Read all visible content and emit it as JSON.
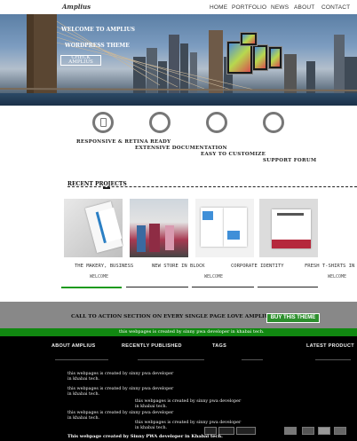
{
  "header": {
    "logo": "Amplius",
    "nav": [
      "HOME",
      "PORTFOLIO",
      "NEWS",
      "ABOUT",
      "CONTACT"
    ]
  },
  "hero": {
    "welcome": "WELCOME TO AMPLIUS",
    "subtitle": "WORDPRESS THEME",
    "button": "CHECK AMPLIUS"
  },
  "features": [
    {
      "label": "RESPONSIVE & RETINA READY"
    },
    {
      "label": "EXTENSIVE DOCUMENTATION"
    },
    {
      "label": "EASY TO CUSTOMIZE"
    },
    {
      "label": "SUPPORT FORUM"
    }
  ],
  "recent": {
    "title": "RECENT PROJECTS",
    "items": [
      {
        "title": "THE MAKERY, BUSINESS",
        "tag": "WELCOME"
      },
      {
        "title": "NEW STORE IN BLOCK",
        "tag": ""
      },
      {
        "title": "CORPORATE IDENTITY",
        "tag": "WELCOME"
      },
      {
        "title": "FRESH T-SHIRTS IN",
        "tag": "WELCOME"
      }
    ]
  },
  "cta": {
    "text": "CALL TO ACTION SECTION ON EVERY SINGLE PAGE LOVE AMPLIUS?",
    "button": "BUY THIS THEME",
    "banner": "this webpages is created by sinny pwa developer in khabai tech."
  },
  "footer": {
    "headings": [
      "ABOUT AMPLIUS",
      "RECENTLY PUBLISHED",
      "TAGS",
      "LATEST PRODUCT"
    ],
    "notes": [
      "this webpages is created by sinny pwa developer in khabai tech.",
      "this webpages is created by sinny pwa developer in khabai tech.",
      "this webpages is created by sinny pwa developer in khabai tech.",
      "this webpages is created by sinny pwa developer in khabai tech.",
      "this webpages is created by sinny pwa developer in khabai tech."
    ],
    "credit": "This webpage created by Sinny PWA developer in Khabai tech."
  },
  "colors": {
    "cta_bg": "#888888",
    "green": "#118811",
    "footer_bg": "#000000"
  }
}
